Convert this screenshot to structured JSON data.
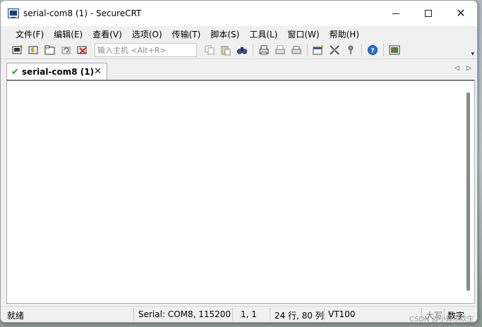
{
  "window": {
    "title": "serial-com8 (1) - SecureCRT",
    "minimize_glyph": "—",
    "maximize_glyph": "☐",
    "close_glyph": "✕"
  },
  "menu": [
    {
      "label": "文件(F)"
    },
    {
      "label": "编辑(E)"
    },
    {
      "label": "查看(V)"
    },
    {
      "label": "选项(O)"
    },
    {
      "label": "传输(T)"
    },
    {
      "label": "脚本(S)"
    },
    {
      "label": "工具(L)"
    },
    {
      "label": "窗口(W)"
    },
    {
      "label": "帮助(H)"
    }
  ],
  "toolbar": {
    "host_input_placeholder": "输入主机 <Alt+R>",
    "icons_group1": [
      "connect-icon",
      "quick-connect-icon",
      "connect-tab-icon",
      "reconnect-icon",
      "disconnect-icon"
    ],
    "icons_group2": [
      "copy-icon",
      "paste-icon",
      "find-icon"
    ],
    "icons_group3": [
      "print-screen-icon",
      "print-selection-icon",
      "print-setup-icon"
    ],
    "icons_group4": [
      "session-options-icon",
      "global-options-icon",
      "keymap-icon"
    ],
    "icons_group5": [
      "help-icon"
    ],
    "icons_group6": [
      "sftp-icon"
    ]
  },
  "tab": {
    "label": "serial-com8 (1)",
    "status_glyph": "✔",
    "close_glyph": "✕",
    "nav_left": "◁",
    "nav_right": "▷"
  },
  "status": {
    "ready": "就绪",
    "serial": "Serial: COM8, 115200",
    "cursor": "1,   1",
    "size": "24 行, 80 列",
    "emulation": "VT100",
    "caps": "大写",
    "num": "数字"
  },
  "watermark": "CSDN @小辉乐欢生",
  "colors": {
    "success_check": "#2e9a2e",
    "terminal_bg": "#ffffff",
    "chrome_bg": "#f0f0f0"
  }
}
